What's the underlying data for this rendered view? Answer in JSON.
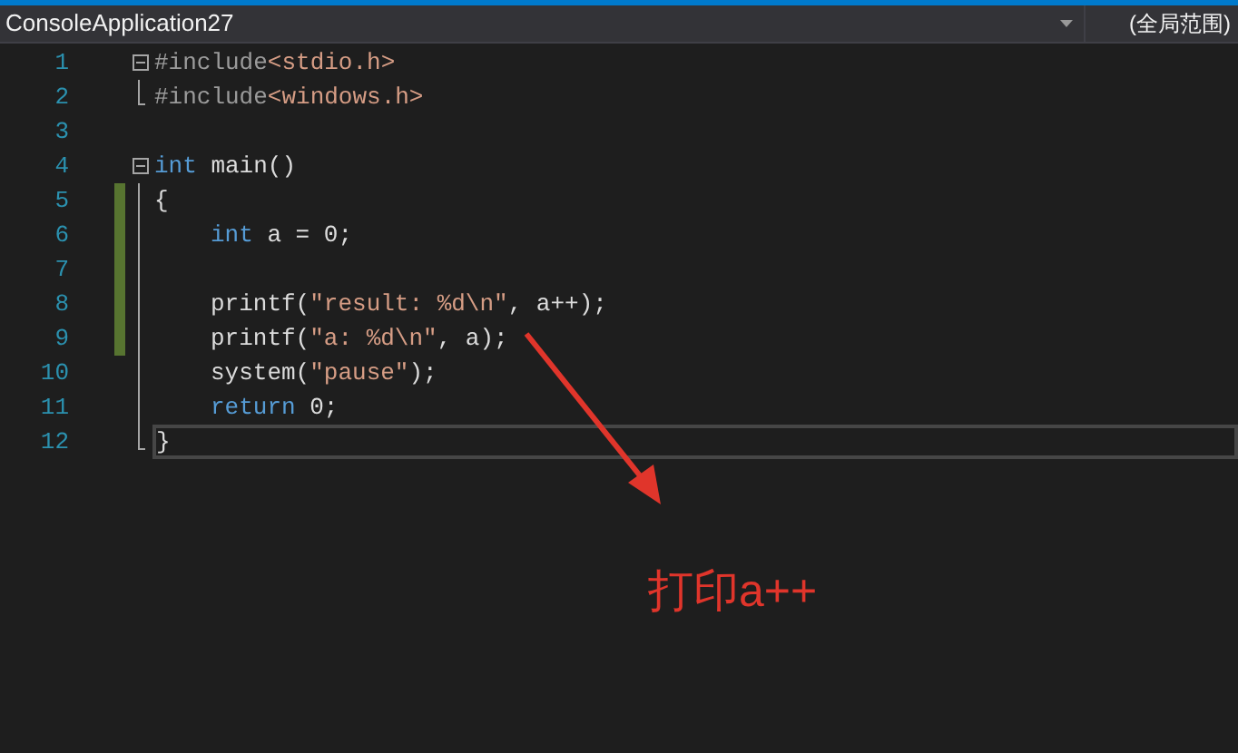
{
  "navigation_bar": {
    "project_dropdown": "ConsoleApplication27",
    "scope_dropdown": "(全局范围)"
  },
  "editor": {
    "lines": [
      {
        "number": "1",
        "kind": "opener",
        "indented": false,
        "modified": false,
        "current": false,
        "tokens": [
          {
            "kind": "preprocessor",
            "text": "#include"
          },
          {
            "kind": "string",
            "text": "<stdio.h>"
          }
        ]
      },
      {
        "number": "2",
        "kind": "closer",
        "indented": false,
        "modified": false,
        "current": false,
        "tokens": [
          {
            "kind": "preprocessor",
            "text": "#include"
          },
          {
            "kind": "string",
            "text": "<windows.h>"
          }
        ]
      },
      {
        "number": "3",
        "kind": "plain",
        "modified": false,
        "current": false
      },
      {
        "number": "4",
        "kind": "opener",
        "indented": false,
        "modified": false,
        "current": false,
        "tokens": [
          {
            "kind": "keyword",
            "text": "int"
          },
          {
            "kind": "plain",
            "text": " main()"
          }
        ]
      },
      {
        "number": "5",
        "kind": "inside",
        "indented": false,
        "modified": true,
        "current": false,
        "tokens": [
          {
            "kind": "plain",
            "text": "{"
          }
        ]
      },
      {
        "number": "6",
        "kind": "inside",
        "indented": true,
        "modified": true,
        "current": false,
        "tokens": [
          {
            "kind": "keyword",
            "text": "int"
          },
          {
            "kind": "plain",
            "text": " a = 0;"
          }
        ]
      },
      {
        "number": "7",
        "kind": "inside",
        "modified": true,
        "current": false
      },
      {
        "number": "8",
        "kind": "inside",
        "indented": true,
        "modified": true,
        "current": false,
        "tokens": [
          {
            "kind": "plain",
            "text": "printf("
          },
          {
            "kind": "string",
            "text": "\"result: %d\\n\""
          },
          {
            "kind": "plain",
            "text": ", a++);"
          }
        ]
      },
      {
        "number": "9",
        "kind": "inside",
        "indented": true,
        "modified": true,
        "current": false,
        "tokens": [
          {
            "kind": "plain",
            "text": "printf("
          },
          {
            "kind": "string",
            "text": "\"a: %d\\n\""
          },
          {
            "kind": "plain",
            "text": ", a);"
          }
        ]
      },
      {
        "number": "10",
        "kind": "inside",
        "indented": true,
        "modified": false,
        "current": false,
        "tokens": [
          {
            "kind": "plain",
            "text": "system("
          },
          {
            "kind": "string",
            "text": "\"pause\""
          },
          {
            "kind": "plain",
            "text": ");"
          }
        ]
      },
      {
        "number": "11",
        "kind": "inside",
        "indented": true,
        "modified": false,
        "current": false,
        "tokens": [
          {
            "kind": "keyword",
            "text": "return"
          },
          {
            "kind": "plain",
            "text": " 0;"
          }
        ]
      },
      {
        "number": "12",
        "kind": "closer",
        "indented": false,
        "modified": false,
        "current": true,
        "tokens": [
          {
            "kind": "plain",
            "text": "}"
          }
        ]
      }
    ]
  },
  "annotation": {
    "text": "打印a++"
  }
}
